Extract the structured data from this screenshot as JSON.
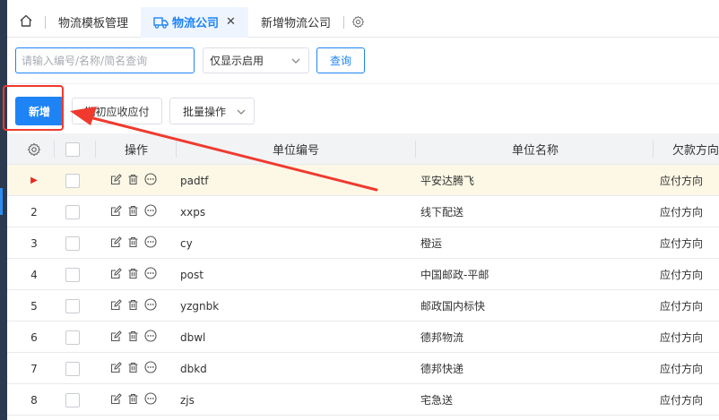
{
  "tabs": {
    "home_icon": "home-icon",
    "items": [
      {
        "label": "物流模板管理",
        "active": false
      },
      {
        "label": "物流公司",
        "active": true,
        "icon": "truck-icon",
        "closable": true
      },
      {
        "label": "新增物流公司",
        "active": false
      }
    ],
    "close_glyph": "✕",
    "gear_icon": "gear-icon"
  },
  "search": {
    "placeholder": "请输入编号/名称/简名查询",
    "value": "",
    "status_select": "仅显示启用",
    "query_label": "查询"
  },
  "toolbar": {
    "add_label": "新增",
    "initial_label": "期初应收应付",
    "batch_label": "批量操作"
  },
  "table": {
    "headers": {
      "ops": "操作",
      "code": "单位编号",
      "name": "单位名称",
      "direction": "欠款方向"
    },
    "rows": [
      {
        "index": "",
        "current": true,
        "code": "padtf",
        "name": "平安达腾飞",
        "direction": "应付方向"
      },
      {
        "index": "2",
        "current": false,
        "code": "xxps",
        "name": "线下配送",
        "direction": "应付方向"
      },
      {
        "index": "3",
        "current": false,
        "code": "cy",
        "name": "橙运",
        "direction": "应付方向"
      },
      {
        "index": "4",
        "current": false,
        "code": "post",
        "name": "中国邮政-平邮",
        "direction": "应付方向"
      },
      {
        "index": "5",
        "current": false,
        "code": "yzgnbk",
        "name": "邮政国内标快",
        "direction": "应付方向"
      },
      {
        "index": "6",
        "current": false,
        "code": "dbwl",
        "name": "德邦物流",
        "direction": "应付方向"
      },
      {
        "index": "7",
        "current": false,
        "code": "dbkd",
        "name": "德邦快递",
        "direction": "应付方向"
      },
      {
        "index": "8",
        "current": false,
        "code": "zjs",
        "name": "宅急送",
        "direction": "应付方向"
      }
    ]
  },
  "annotation": {
    "highlight_color": "#f03a2e",
    "accent": "#1e84f5"
  }
}
